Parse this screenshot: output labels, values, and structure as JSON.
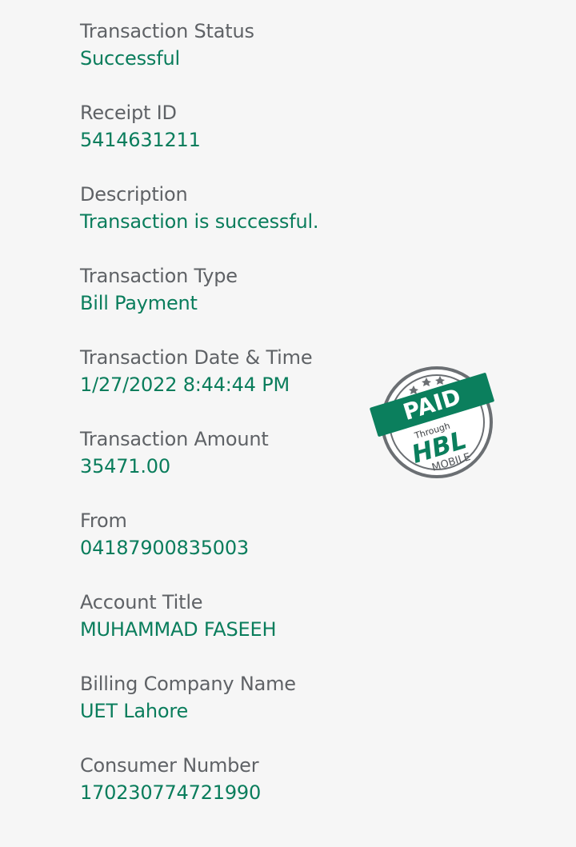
{
  "receipt": {
    "fields": [
      {
        "label": "Transaction Status",
        "value": "Successful"
      },
      {
        "label": "Receipt ID",
        "value": "5414631211"
      },
      {
        "label": "Description",
        "value": "Transaction is successful."
      },
      {
        "label": "Transaction Type",
        "value": "Bill Payment"
      },
      {
        "label": "Transaction Date & Time",
        "value": "1/27/2022 8:44:44 PM"
      },
      {
        "label": "Transaction Amount",
        "value": "35471.00"
      },
      {
        "label": "From",
        "value": "04187900835003"
      },
      {
        "label": "Account Title",
        "value": "MUHAMMAD FASEEH"
      },
      {
        "label": "Billing Company Name",
        "value": "UET Lahore"
      },
      {
        "label": "Consumer Number",
        "value": "170230774721990"
      }
    ]
  },
  "stamp": {
    "paid": "PAID",
    "through": "Through",
    "brand": "HBL",
    "mobile": "MOBILE",
    "icon": "paid-stamp-icon"
  },
  "colors": {
    "background": "#f6f6f6",
    "label": "#5f6266",
    "value": "#0a7d5c",
    "stamp_green": "#0b7f5d",
    "stamp_ring": "#6b6f73"
  }
}
